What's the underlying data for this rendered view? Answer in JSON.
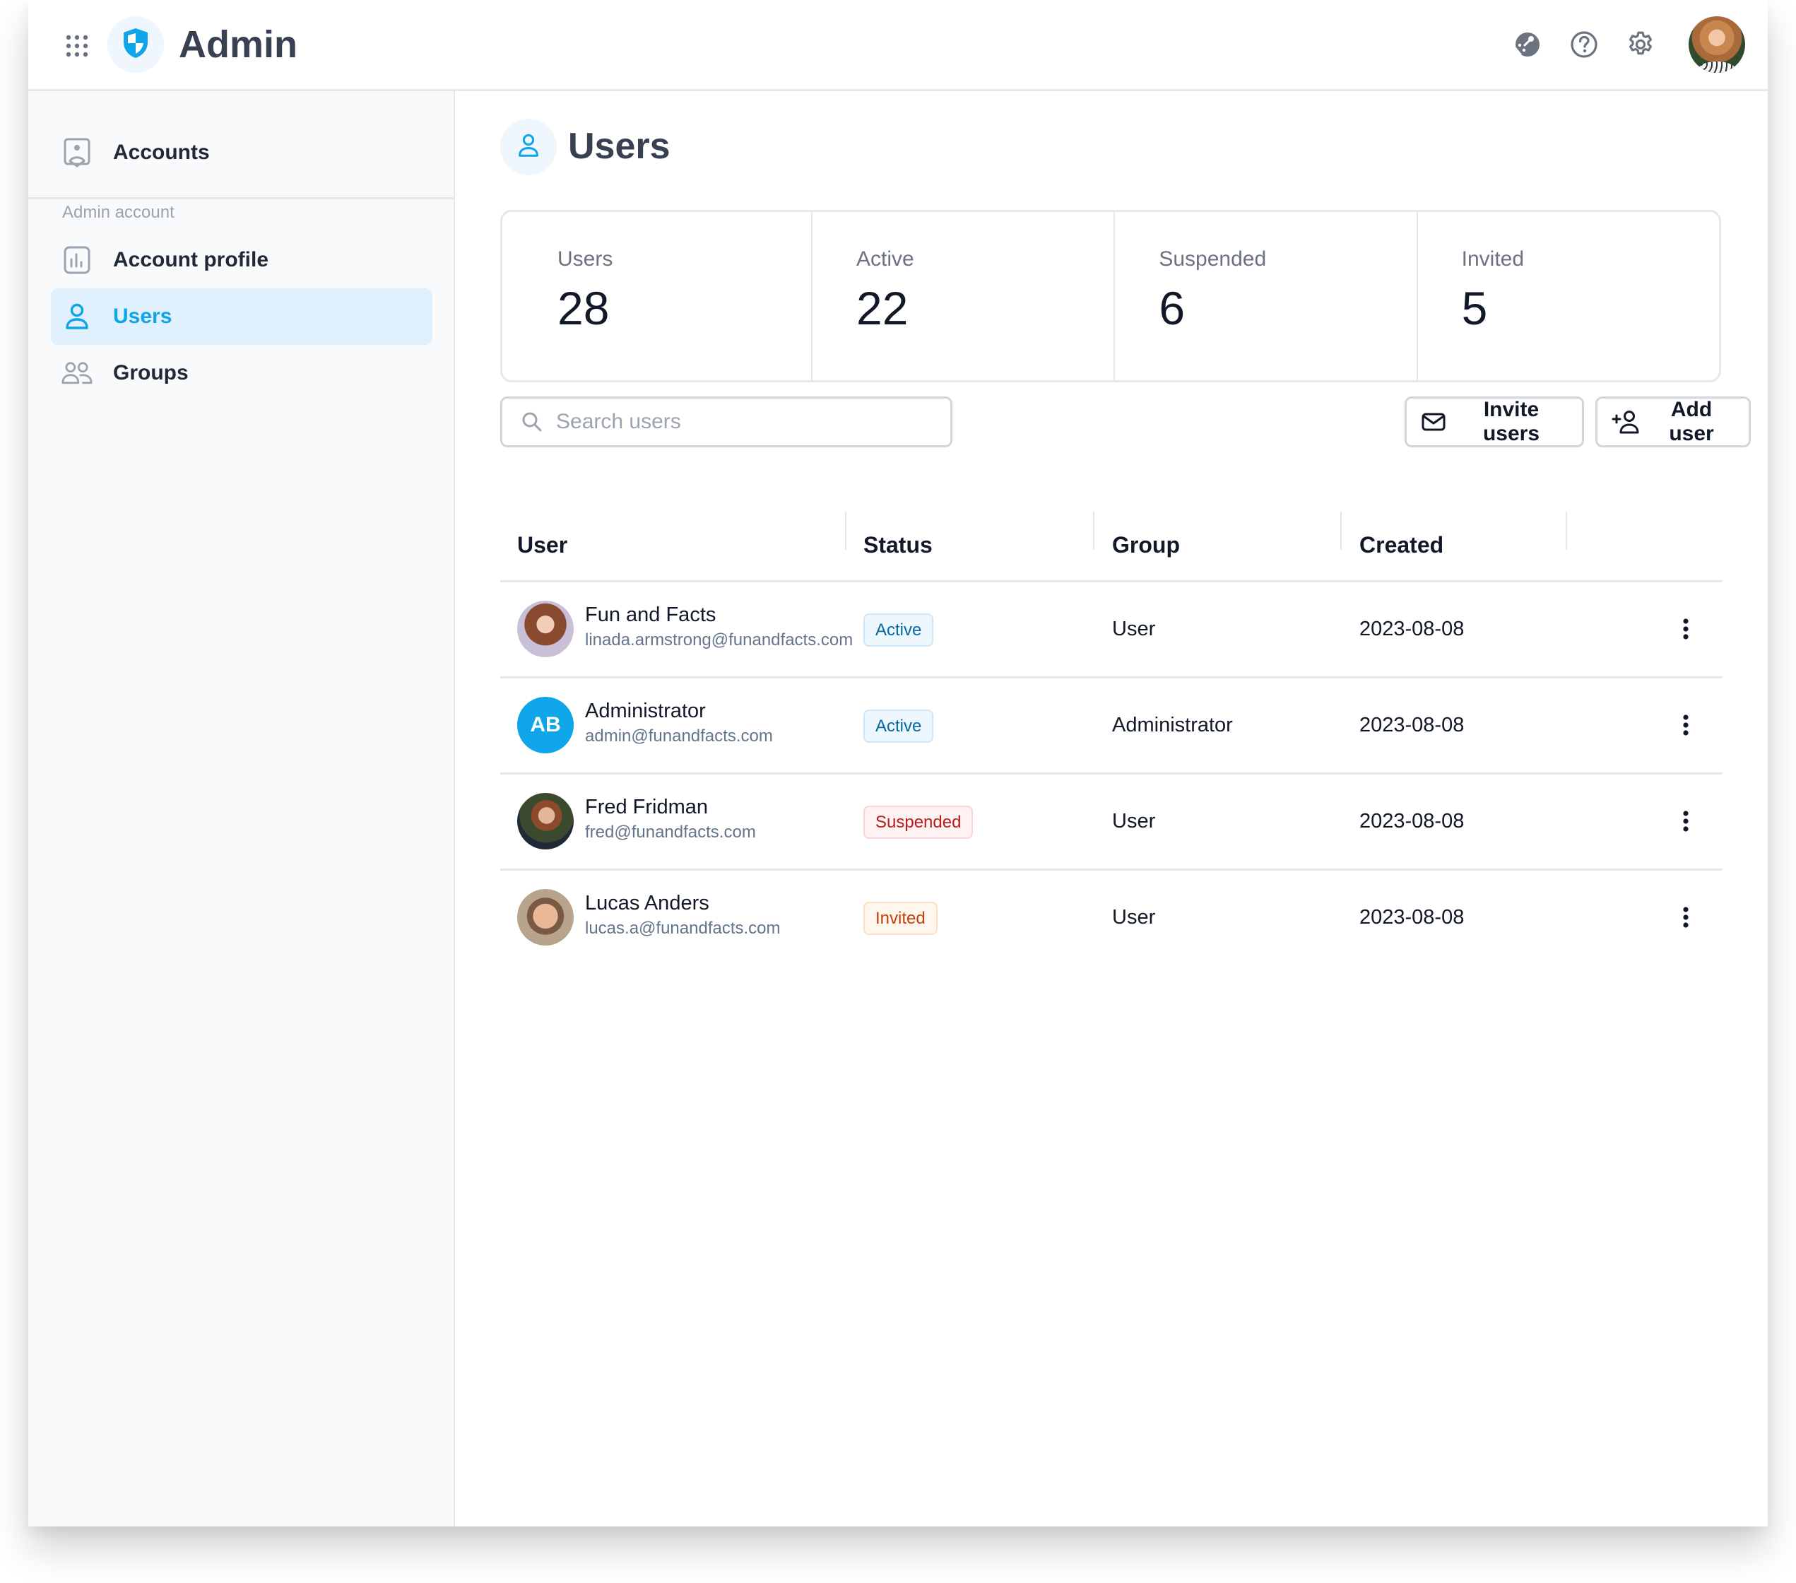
{
  "header": {
    "app_title": "Admin",
    "icons": [
      "apps-grid-icon",
      "shield-logo-icon",
      "whats-new-icon",
      "help-icon",
      "settings-icon",
      "user-avatar"
    ]
  },
  "sidebar": {
    "top_items": [
      {
        "label": "Accounts",
        "icon": "accounts-icon"
      }
    ],
    "section_label": "Admin account",
    "items": [
      {
        "label": "Account profile",
        "icon": "chart-icon",
        "active": false
      },
      {
        "label": "Users",
        "icon": "user-icon",
        "active": true
      },
      {
        "label": "Groups",
        "icon": "groups-icon",
        "active": false
      }
    ]
  },
  "page": {
    "title": "Users",
    "icon": "user-icon"
  },
  "stats": [
    {
      "label": "Users",
      "value": "28"
    },
    {
      "label": "Active",
      "value": "22"
    },
    {
      "label": "Suspended",
      "value": "6"
    },
    {
      "label": "Invited",
      "value": "5"
    }
  ],
  "toolbar": {
    "search_placeholder": "Search users",
    "search_value": "",
    "invite_label": "Invite users",
    "add_label": "Add user"
  },
  "table": {
    "columns": [
      "User",
      "Status",
      "Group",
      "Created"
    ],
    "rows": [
      {
        "name": "Fun and Facts",
        "email": "linada.armstrong@funandfacts.com",
        "avatar": "photo",
        "initials": "",
        "status": "Active",
        "status_type": "active",
        "group": "User",
        "created": "2023-08-08"
      },
      {
        "name": "Administrator",
        "email": "admin@funandfacts.com",
        "avatar": "initials",
        "initials": "AB",
        "status": "Active",
        "status_type": "active",
        "group": "Administrator",
        "created": "2023-08-08"
      },
      {
        "name": "Fred Fridman",
        "email": "fred@funandfacts.com",
        "avatar": "photo",
        "initials": "",
        "status": "Suspended",
        "status_type": "suspended",
        "group": "User",
        "created": "2023-08-08"
      },
      {
        "name": "Lucas Anders",
        "email": "lucas.a@funandfacts.com",
        "avatar": "photo",
        "initials": "",
        "status": "Invited",
        "status_type": "invited",
        "group": "User",
        "created": "2023-08-08"
      }
    ]
  },
  "colors": {
    "accent": "#0ea5e9",
    "active_nav_bg": "#e0f0fc",
    "status_active": "#0369a1",
    "status_suspended": "#b91c1c",
    "status_invited": "#c2410c"
  }
}
